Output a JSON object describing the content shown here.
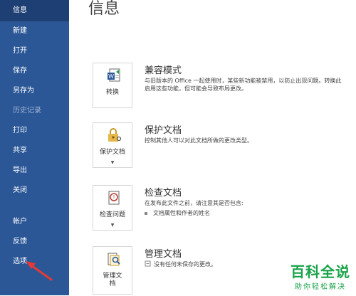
{
  "sidebar": {
    "items": [
      {
        "label": "信息"
      },
      {
        "label": "新建"
      },
      {
        "label": "打开"
      },
      {
        "label": "保存"
      },
      {
        "label": "另存为"
      },
      {
        "label": "历史记录"
      },
      {
        "label": "打印"
      },
      {
        "label": "共享"
      },
      {
        "label": "导出"
      },
      {
        "label": "关闭"
      },
      {
        "label": "帐户"
      },
      {
        "label": "反馈"
      },
      {
        "label": "选项"
      }
    ]
  },
  "main": {
    "title": "信息",
    "sections": [
      {
        "tile_label": "转换",
        "title": "兼容模式",
        "desc_line1": "与旧版本的 Office 一起使用时，某些新功能被禁用，以防止出现问题。转换此",
        "desc_line2": "启用这些功能，但可能会导致布局更改。"
      },
      {
        "tile_label": "保护文档",
        "title": "保护文档",
        "desc_line1": "控制其他人可以对此文档所做的更改类型。"
      },
      {
        "tile_label": "检查问题",
        "title": "检查文档",
        "desc_line1": "在发布此文件之前，请注意其是否包含:",
        "bullet1": "文档属性和作者的姓名"
      },
      {
        "tile_label_line1": "管理文",
        "tile_label_line2": "档",
        "title": "管理文档",
        "desc_line1": "没有任何未保存的更改。"
      }
    ]
  },
  "watermark": {
    "main": "百科全说",
    "sub": "助你轻松解决"
  },
  "colors": {
    "sidebar": "#2b5797",
    "sidebar_active": "#1e3f73",
    "annotation_arrow": "#e53935",
    "watermark": "#1aa34a"
  }
}
